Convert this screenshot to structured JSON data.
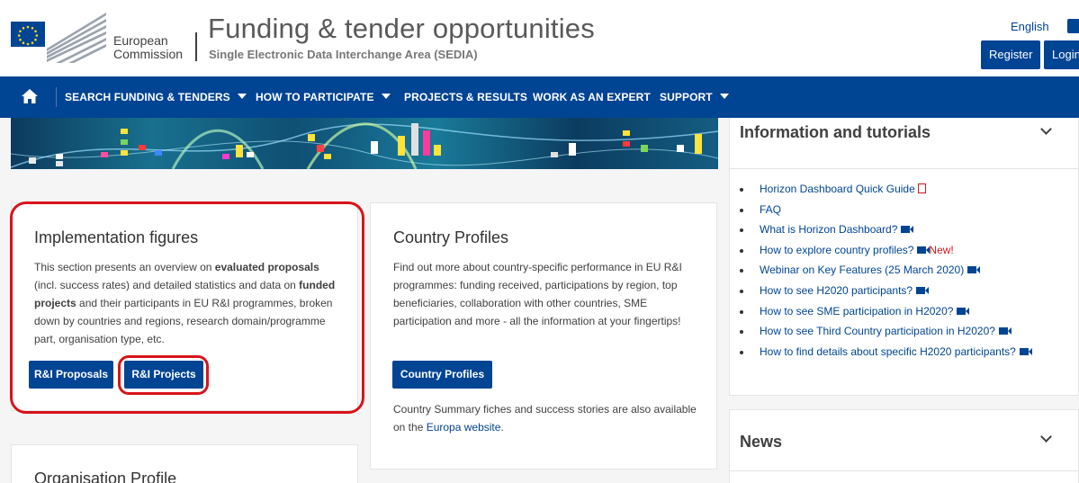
{
  "header": {
    "ec_line1": "European",
    "ec_line2": "Commission",
    "title": "Funding & tender opportunities",
    "subtitle": "Single Electronic Data Interchange Area (SEDIA)",
    "language": "English",
    "register_label": "Register",
    "login_label": "Login"
  },
  "nav": {
    "items": [
      {
        "label": "SEARCH FUNDING & TENDERS",
        "has_caret": true
      },
      {
        "label": "HOW TO PARTICIPATE",
        "has_caret": true
      },
      {
        "label": "PROJECTS & RESULTS",
        "has_caret": false
      },
      {
        "label": "WORK AS AN EXPERT",
        "has_caret": false
      },
      {
        "label": "SUPPORT",
        "has_caret": true
      }
    ]
  },
  "implementation": {
    "title": "Implementation figures",
    "text_1": "This section presents an overview on ",
    "text_bold_1": "evaluated proposals",
    "text_2": " (incl. success rates) and detailed statistics and data on ",
    "text_bold_2": "funded projects",
    "text_3": " and their participants in EU R&I programmes, broken down by countries and regions, research domain/programme part, organisation type, etc.",
    "btn_proposals": "R&I Proposals",
    "btn_projects": "R&I Projects"
  },
  "country": {
    "title": "Country Profiles",
    "text": "Find out more about country-specific performance in EU R&I programmes: funding received, participations by region, top beneficiaries, collaboration with other countries, SME participation and more - all the information at your fingertips!",
    "btn": "Country Profiles",
    "footer_text": "Country Summary fiches and success stories are also available on the ",
    "footer_link": "Europa website",
    "footer_end": "."
  },
  "organisation": {
    "title": "Organisation Profile"
  },
  "info": {
    "title": "Information and tutorials",
    "items": [
      {
        "label": "Horizon Dashboard Quick Guide",
        "icon": "pdf-icon"
      },
      {
        "label": "FAQ",
        "icon": ""
      },
      {
        "label": "What is Horizon Dashboard?",
        "icon": "video-icon"
      },
      {
        "label": "How to explore country profiles?",
        "icon": "video-icon",
        "badge": "New!"
      },
      {
        "label": "Webinar on Key Features (25 March 2020)",
        "icon": "video-icon"
      },
      {
        "label": "How to see H2020 participants?",
        "icon": "video-icon"
      },
      {
        "label": "How to see SME participation in H2020?",
        "icon": "video-icon"
      },
      {
        "label": "How to see Third Country participation in H2020?",
        "icon": "video-icon"
      },
      {
        "label": "How to find details about specific H2020 participants?",
        "icon": "video-icon"
      }
    ]
  },
  "news": {
    "title": "News"
  },
  "colors": {
    "primary": "#004494",
    "highlight": "#d7141a",
    "eu_yellow": "#ffd617"
  }
}
